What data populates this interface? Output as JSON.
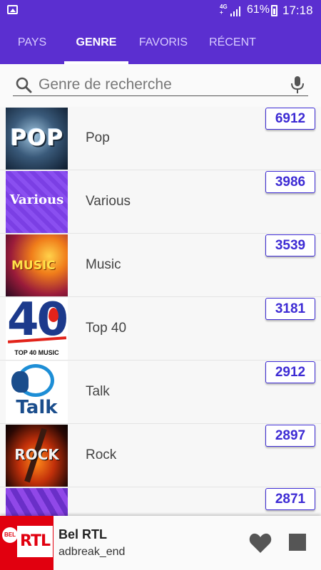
{
  "status_bar": {
    "network": "4G",
    "network_sub": "+",
    "battery": "61%",
    "time": "17:18"
  },
  "tabs": [
    {
      "label": "PAYS",
      "active": false
    },
    {
      "label": "GENRE",
      "active": true
    },
    {
      "label": "FAVORIS",
      "active": false
    },
    {
      "label": "RÉCENT",
      "active": false
    }
  ],
  "search": {
    "placeholder": "Genre de recherche",
    "value": ""
  },
  "genres": [
    {
      "label": "Pop",
      "count": "6912",
      "thumb_text": "POP"
    },
    {
      "label": "Various",
      "count": "3986",
      "thumb_text": "Various"
    },
    {
      "label": "Music",
      "count": "3539",
      "thumb_text": "MUSIC"
    },
    {
      "label": "Top 40",
      "count": "3181",
      "thumb_text": "40",
      "thumb_caption": "TOP 40 MUSIC"
    },
    {
      "label": "Talk",
      "count": "2912",
      "thumb_text": "Talk"
    },
    {
      "label": "Rock",
      "count": "2897",
      "thumb_text": "ROCK"
    },
    {
      "label": "",
      "count": "2871",
      "thumb_text": ""
    }
  ],
  "player": {
    "logo_text": "RTL",
    "logo_badge": "BEL",
    "title": "Bel RTL",
    "subtitle": "adbreak_end"
  },
  "colors": {
    "accent": "#5b2fd0",
    "badge": "#3d2bd4",
    "rtl_red": "#e1000f"
  }
}
